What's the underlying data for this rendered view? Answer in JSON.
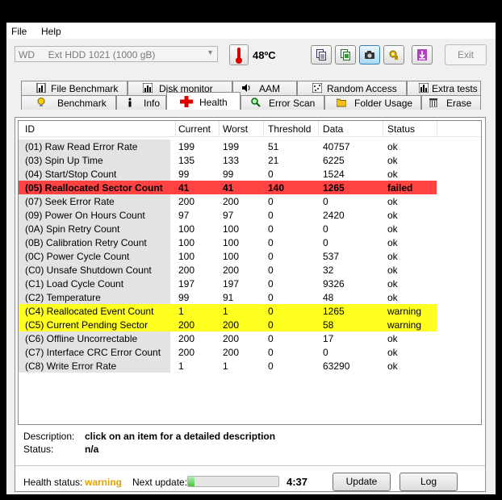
{
  "menu": {
    "file": "File",
    "help": "Help"
  },
  "toolbar": {
    "drive": "WD     Ext HDD 1021 (1000 gB)",
    "temperature": "48",
    "temperature_unit": "ºC",
    "exit_label": "Exit",
    "buttons": [
      "copy-text-icon",
      "copy-info-icon",
      "screenshot-icon",
      "options-icon",
      "save-icon"
    ]
  },
  "tabs": {
    "row1": [
      "File Benchmark",
      "Disk monitor",
      "AAM",
      "Random Access",
      "Extra tests"
    ],
    "row2": [
      "Benchmark",
      "Info",
      "Health",
      "Error Scan",
      "Folder Usage",
      "Erase"
    ],
    "active": "Health"
  },
  "table": {
    "columns": [
      "ID",
      "Current",
      "Worst",
      "Threshold",
      "Data",
      "Status"
    ],
    "rows": [
      {
        "id": "(01) Raw Read Error Rate",
        "current": "199",
        "worst": "199",
        "threshold": "51",
        "data": "40757",
        "status": "ok",
        "level": "ok"
      },
      {
        "id": "(03) Spin Up Time",
        "current": "135",
        "worst": "133",
        "threshold": "21",
        "data": "6225",
        "status": "ok",
        "level": "ok"
      },
      {
        "id": "(04) Start/Stop Count",
        "current": "99",
        "worst": "99",
        "threshold": "0",
        "data": "1524",
        "status": "ok",
        "level": "ok"
      },
      {
        "id": "(05) Reallocated Sector Count",
        "current": "41",
        "worst": "41",
        "threshold": "140",
        "data": "1265",
        "status": "failed",
        "level": "failed"
      },
      {
        "id": "(07) Seek Error Rate",
        "current": "200",
        "worst": "200",
        "threshold": "0",
        "data": "0",
        "status": "ok",
        "level": "ok"
      },
      {
        "id": "(09) Power On Hours Count",
        "current": "97",
        "worst": "97",
        "threshold": "0",
        "data": "2420",
        "status": "ok",
        "level": "ok"
      },
      {
        "id": "(0A) Spin Retry Count",
        "current": "100",
        "worst": "100",
        "threshold": "0",
        "data": "0",
        "status": "ok",
        "level": "ok"
      },
      {
        "id": "(0B) Calibration Retry Count",
        "current": "100",
        "worst": "100",
        "threshold": "0",
        "data": "0",
        "status": "ok",
        "level": "ok"
      },
      {
        "id": "(0C) Power Cycle Count",
        "current": "100",
        "worst": "100",
        "threshold": "0",
        "data": "537",
        "status": "ok",
        "level": "ok"
      },
      {
        "id": "(C0) Unsafe Shutdown Count",
        "current": "200",
        "worst": "200",
        "threshold": "0",
        "data": "32",
        "status": "ok",
        "level": "ok"
      },
      {
        "id": "(C1) Load Cycle Count",
        "current": "197",
        "worst": "197",
        "threshold": "0",
        "data": "9326",
        "status": "ok",
        "level": "ok"
      },
      {
        "id": "(C2) Temperature",
        "current": "99",
        "worst": "91",
        "threshold": "0",
        "data": "48",
        "status": "ok",
        "level": "ok"
      },
      {
        "id": "(C4) Reallocated Event Count",
        "current": "1",
        "worst": "1",
        "threshold": "0",
        "data": "1265",
        "status": "warning",
        "level": "warning"
      },
      {
        "id": "(C5) Current Pending Sector",
        "current": "200",
        "worst": "200",
        "threshold": "0",
        "data": "58",
        "status": "warning",
        "level": "warning"
      },
      {
        "id": "(C6) Offline Uncorrectable",
        "current": "200",
        "worst": "200",
        "threshold": "0",
        "data": "17",
        "status": "ok",
        "level": "ok"
      },
      {
        "id": "(C7) Interface CRC Error Count",
        "current": "200",
        "worst": "200",
        "threshold": "0",
        "data": "0",
        "status": "ok",
        "level": "ok"
      },
      {
        "id": "(C8) Write Error Rate",
        "current": "1",
        "worst": "1",
        "threshold": "0",
        "data": "63290",
        "status": "ok",
        "level": "ok"
      }
    ]
  },
  "description": {
    "label": "Description:",
    "value": "click on an item for a detailed description",
    "status_label": "Status:",
    "status_value": "n/a"
  },
  "footer": {
    "health_label": "Health status:",
    "health_value": "warning",
    "next_update_label": "Next update:",
    "progress": 0.07,
    "countdown": "4:37",
    "update_button": "Update",
    "log_button": "Log"
  },
  "colors": {
    "failed": "#ff4242",
    "warning": "#ffff20",
    "health_warning": "#e0a000"
  }
}
